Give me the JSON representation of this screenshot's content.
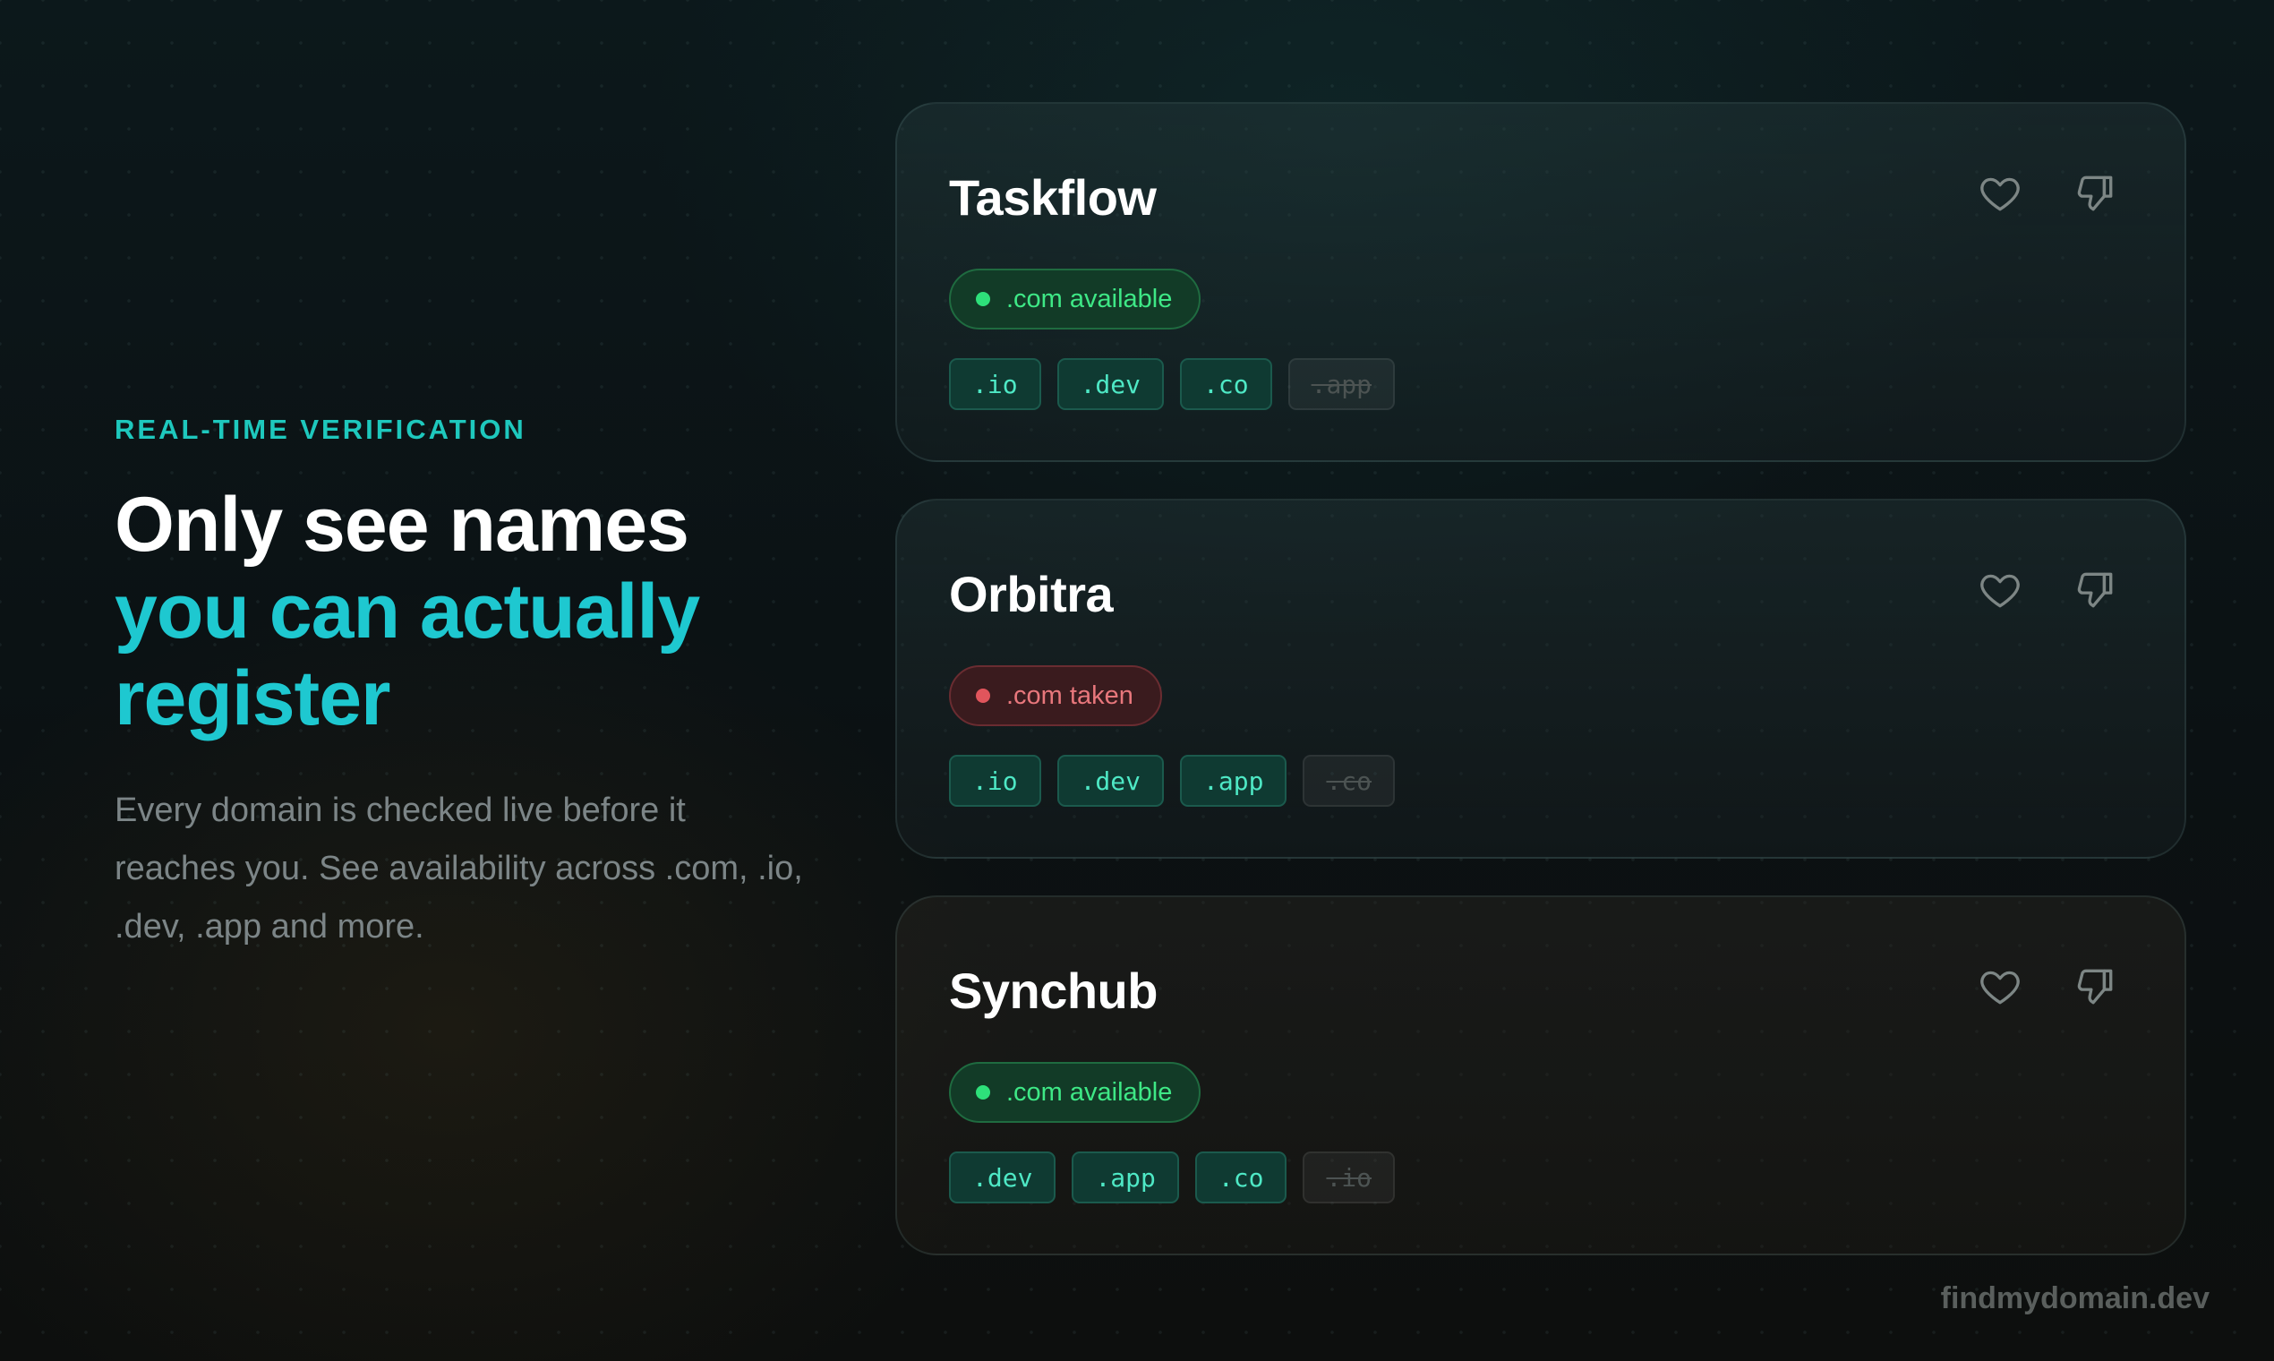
{
  "hero": {
    "eyebrow": "REAL-TIME VERIFICATION",
    "headline_line1": "Only see names",
    "headline_line2": "you can actually",
    "headline_line3": "register",
    "description": "Every domain is checked live before it reaches you. See availability across .com, .io, .dev, .app and more."
  },
  "colors": {
    "accent": "#1ec8d0",
    "available": "#2ee07a",
    "taken": "#e1555c",
    "tld_active": "#4ee8c5"
  },
  "cards": [
    {
      "name": "Taskflow",
      "status": "available",
      "status_label": ".com available",
      "like_icon": "heart-icon",
      "dislike_icon": "thumbs-down-icon",
      "tlds": [
        {
          "label": ".io",
          "available": true
        },
        {
          "label": ".dev",
          "available": true
        },
        {
          "label": ".co",
          "available": true
        },
        {
          "label": ".app",
          "available": false
        }
      ]
    },
    {
      "name": "Orbitra",
      "status": "taken",
      "status_label": ".com taken",
      "like_icon": "heart-icon",
      "dislike_icon": "thumbs-down-icon",
      "tlds": [
        {
          "label": ".io",
          "available": true
        },
        {
          "label": ".dev",
          "available": true
        },
        {
          "label": ".app",
          "available": true
        },
        {
          "label": ".co",
          "available": false
        }
      ]
    },
    {
      "name": "Synchub",
      "status": "available",
      "status_label": ".com available",
      "like_icon": "heart-icon",
      "dislike_icon": "thumbs-down-icon",
      "tlds": [
        {
          "label": ".dev",
          "available": true
        },
        {
          "label": ".app",
          "available": true
        },
        {
          "label": ".co",
          "available": true
        },
        {
          "label": ".io",
          "available": false
        }
      ]
    }
  ],
  "footer": {
    "brand": "findmydomain.dev"
  }
}
